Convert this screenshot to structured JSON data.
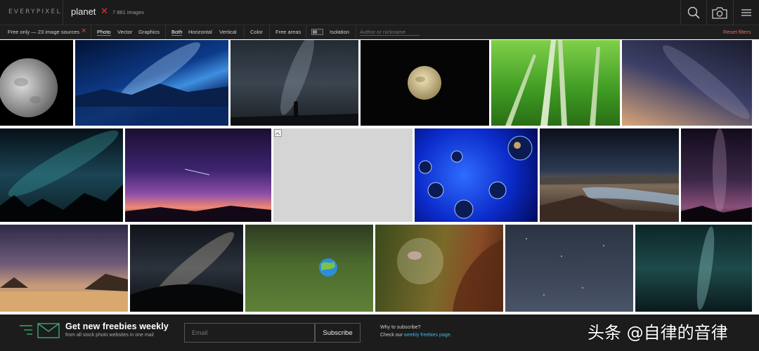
{
  "header": {
    "logo": "EVERYPIXEL",
    "query": "planet",
    "clear_icon": "close-icon",
    "count": "7 881 images",
    "icons": [
      "search-icon",
      "camera-icon",
      "menu-icon"
    ]
  },
  "filters": {
    "free_only": "Free only — 23 image sources",
    "types": [
      "Photo",
      "Vector",
      "Graphics"
    ],
    "active_type": "Photo",
    "orientations": [
      "Both",
      "Horizontal",
      "Vertical"
    ],
    "active_orientation": "Both",
    "color": "Color",
    "free_areas": "Free areas",
    "isolation": "Isolation",
    "author_placeholder": "Author or nickname",
    "reset": "Reset filters"
  },
  "gallery": {
    "tiles": [
      "moon-half",
      "milky-way-mountains-blue",
      "milky-way-silhouette",
      "full-moon",
      "bamboo-forest",
      "starry-sky-orange-horizon",
      "stars-trees",
      "purple-sky-meteor",
      "broken-image",
      "blue-bubbles",
      "river-valley-night",
      "milky-way-vertical",
      "night-beach",
      "milky-way-fisheye",
      "globe-grass",
      "soap-bubble-girl",
      "dark-starry-sky",
      "teal-milky-way"
    ]
  },
  "banner": {
    "icon": "envelope-icon",
    "headline": "Get new freebies weekly",
    "sub": "from all stock photo websites in one mail",
    "email_placeholder": "Email",
    "subscribe": "Subscribe",
    "why": "Why to subscribe?",
    "check": "Check our ",
    "link": "weekly freebies page."
  },
  "watermark": "头条 @自律的音律",
  "colors": {
    "accent": "#3ca76f",
    "reset": "#f16262",
    "link": "#3fb6ea",
    "clear": "#dd3333"
  }
}
